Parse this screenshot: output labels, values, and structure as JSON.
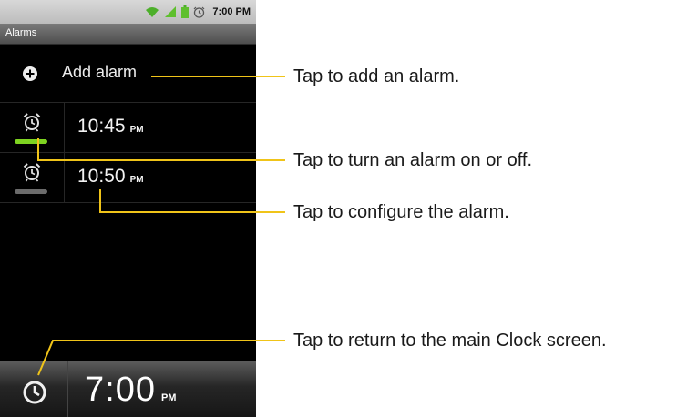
{
  "status_bar": {
    "time": "7:00 PM",
    "icons": [
      "wifi-icon",
      "signal-icon",
      "battery-icon",
      "alarm-status-icon"
    ]
  },
  "title_bar": {
    "title": "Alarms"
  },
  "add_alarm": {
    "label": "Add alarm",
    "icon": "plus-circle-icon"
  },
  "alarms": [
    {
      "time": "10:45",
      "ampm": "PM",
      "enabled": true,
      "toggle_color": "#7ed321"
    },
    {
      "time": "10:50",
      "ampm": "PM",
      "enabled": false,
      "toggle_color": "#6b6b6b"
    }
  ],
  "bottom_bar": {
    "time": "7:00",
    "ampm": "PM",
    "icon": "clock-icon"
  },
  "callouts": [
    "Tap to add an alarm.",
    "Tap to turn an alarm on or off.",
    "Tap to configure the alarm.",
    "Tap to return to the main Clock screen."
  ],
  "colors": {
    "callout_line": "#f0c419",
    "toggle_on": "#7ed321",
    "toggle_off": "#6b6b6b"
  }
}
